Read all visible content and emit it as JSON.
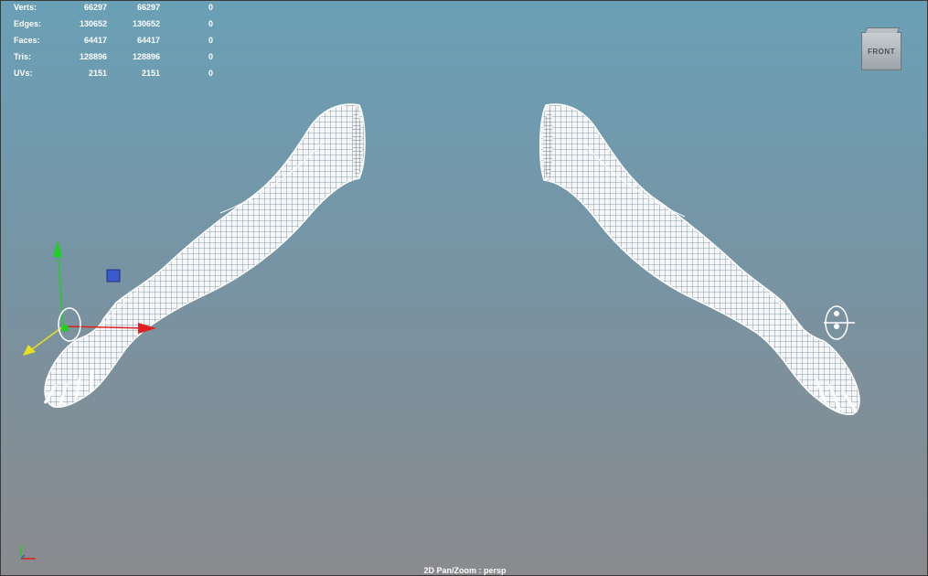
{
  "stats": [
    {
      "label": "Verts:",
      "c1": "66297",
      "c2": "66297",
      "c3": "0"
    },
    {
      "label": "Edges:",
      "c1": "130652",
      "c2": "130652",
      "c3": "0"
    },
    {
      "label": "Faces:",
      "c1": "64417",
      "c2": "64417",
      "c3": "0"
    },
    {
      "label": "Tris:",
      "c1": "128896",
      "c2": "128896",
      "c3": "0"
    },
    {
      "label": "UVs:",
      "c1": "2151",
      "c2": "2151",
      "c3": "0"
    }
  ],
  "viewcube": {
    "label": "FRONT"
  },
  "status": {
    "camera": "2D Pan/Zoom : persp"
  },
  "colors": {
    "bg_top": "#6aa0b6",
    "bg_bottom": "#8a8b8e",
    "mesh": "#ffffff",
    "axis_x": "#e02020",
    "axis_y": "#20d020",
    "axis_z": "#e8e020",
    "manip_box": "#3a5bd0"
  },
  "icons": {
    "manipulator": "move-manipulator-icon",
    "axis_indicator": "axis-indicator-icon"
  }
}
